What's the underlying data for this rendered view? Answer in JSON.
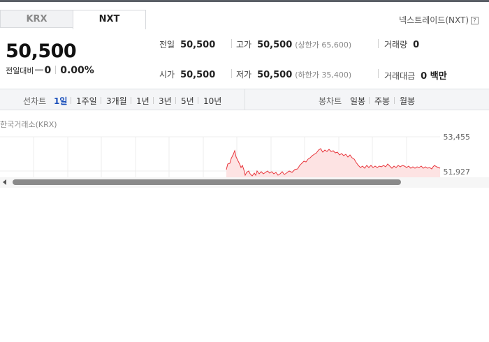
{
  "tabs": [
    {
      "label": "KRX",
      "active": false
    },
    {
      "label": "NXT",
      "active": true
    }
  ],
  "nxt_link": "넥스트레이드(NXT)",
  "help_icon": "help-icon",
  "price": {
    "current": "50,500",
    "change_label": "전일대비",
    "change_value": "0",
    "change_pct": "0.00%"
  },
  "stats": {
    "prev_close": {
      "label": "전일",
      "value": "50,500"
    },
    "open": {
      "label": "시가",
      "value": "50,500"
    },
    "high": {
      "label": "고가",
      "value": "50,500",
      "limit": "(상한가 65,600)"
    },
    "low": {
      "label": "저가",
      "value": "50,500",
      "limit": "(하한가 35,400)"
    },
    "volume": {
      "label": "거래량",
      "value": "0"
    },
    "amount": {
      "label": "거래대금",
      "value": "0 백만"
    }
  },
  "period": {
    "line_label": "선차트",
    "line_items": [
      "1일",
      "1주일",
      "3개월",
      "1년",
      "3년",
      "5년",
      "10년"
    ],
    "active": "1일",
    "candle_label": "봉차트",
    "candle_items": [
      "일봉",
      "주봉",
      "월봉"
    ]
  },
  "chart": {
    "source": "한국거래소(KRX)",
    "y_top": "53,455",
    "y_low": "51,927",
    "line_color": "#e8343a",
    "fill_color": "#fde3e3"
  }
}
